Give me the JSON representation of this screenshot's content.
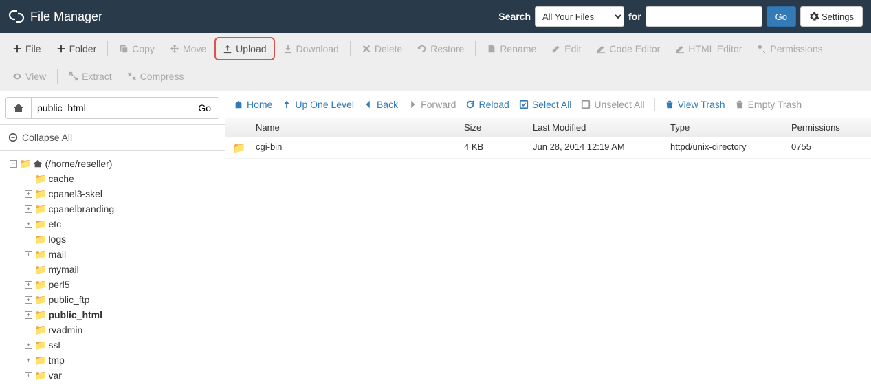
{
  "header": {
    "title": "File Manager",
    "search_label": "Search",
    "scope_select": "All Your Files",
    "for_label": "for",
    "search_value": "",
    "go": "Go",
    "settings": "Settings"
  },
  "toolbar": {
    "file": "File",
    "folder": "Folder",
    "copy": "Copy",
    "move": "Move",
    "upload": "Upload",
    "download": "Download",
    "delete": "Delete",
    "restore": "Restore",
    "rename": "Rename",
    "edit": "Edit",
    "code_editor": "Code Editor",
    "html_editor": "HTML Editor",
    "permissions": "Permissions",
    "view": "View",
    "extract": "Extract",
    "compress": "Compress"
  },
  "sidebar": {
    "path_value": "public_html",
    "go": "Go",
    "collapse_all": "Collapse All",
    "root_label": "(/home/reseller)",
    "tree": [
      {
        "label": "cache",
        "expandable": false
      },
      {
        "label": "cpanel3-skel",
        "expandable": true
      },
      {
        "label": "cpanelbranding",
        "expandable": true
      },
      {
        "label": "etc",
        "expandable": true
      },
      {
        "label": "logs",
        "expandable": false
      },
      {
        "label": "mail",
        "expandable": true
      },
      {
        "label": "mymail",
        "expandable": false
      },
      {
        "label": "perl5",
        "expandable": true
      },
      {
        "label": "public_ftp",
        "expandable": true
      },
      {
        "label": "public_html",
        "expandable": true,
        "bold": true
      },
      {
        "label": "rvadmin",
        "expandable": false
      },
      {
        "label": "ssl",
        "expandable": true
      },
      {
        "label": "tmp",
        "expandable": true
      },
      {
        "label": "var",
        "expandable": true
      }
    ]
  },
  "actions": {
    "home": "Home",
    "up": "Up One Level",
    "back": "Back",
    "forward": "Forward",
    "reload": "Reload",
    "select_all": "Select All",
    "unselect_all": "Unselect All",
    "view_trash": "View Trash",
    "empty_trash": "Empty Trash"
  },
  "table": {
    "headers": {
      "name": "Name",
      "size": "Size",
      "modified": "Last Modified",
      "type": "Type",
      "permissions": "Permissions"
    },
    "rows": [
      {
        "name": "cgi-bin",
        "size": "4 KB",
        "modified": "Jun 28, 2014 12:19 AM",
        "type": "httpd/unix-directory",
        "permissions": "0755"
      }
    ]
  }
}
